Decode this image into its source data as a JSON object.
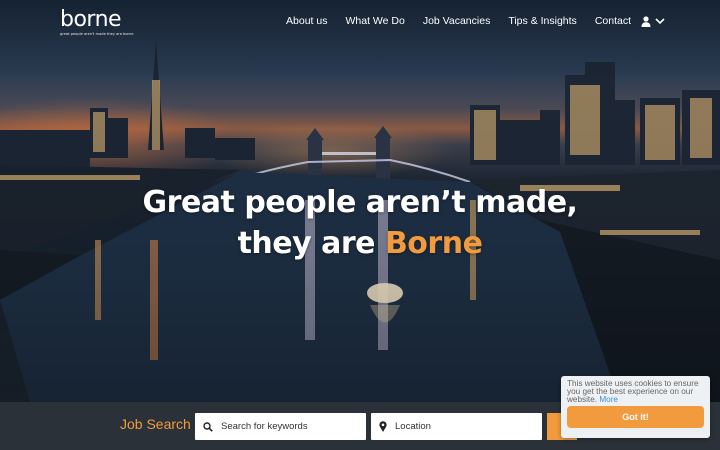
{
  "brand": {
    "logo_text": "borne",
    "tagline": "great people aren't made they are borne"
  },
  "nav": {
    "items": [
      {
        "label": "About us"
      },
      {
        "label": "What We Do"
      },
      {
        "label": "Job Vacancies"
      },
      {
        "label": "Tips & Insights"
      },
      {
        "label": "Contact"
      }
    ],
    "account_icon": "user-icon",
    "dropdown_icon": "chevron-down-icon"
  },
  "hero": {
    "headline_line1": "Great people aren’t made,",
    "headline_line2_prefix": "they are ",
    "headline_line2_accent": "Borne"
  },
  "job_search": {
    "title": "Job Search",
    "keywords_placeholder": "Search for keywords",
    "location_placeholder": "Location",
    "keywords_icon": "search-icon",
    "location_icon": "map-pin-icon"
  },
  "cookie_banner": {
    "message": "This website uses cookies to ensure you get the best experience on our website.",
    "more_link": "More",
    "accept_label": "Got it!"
  },
  "colors": {
    "accent": "#f19a3e",
    "search_bar_bg": "#2b3138",
    "link": "#3b8fd6"
  }
}
